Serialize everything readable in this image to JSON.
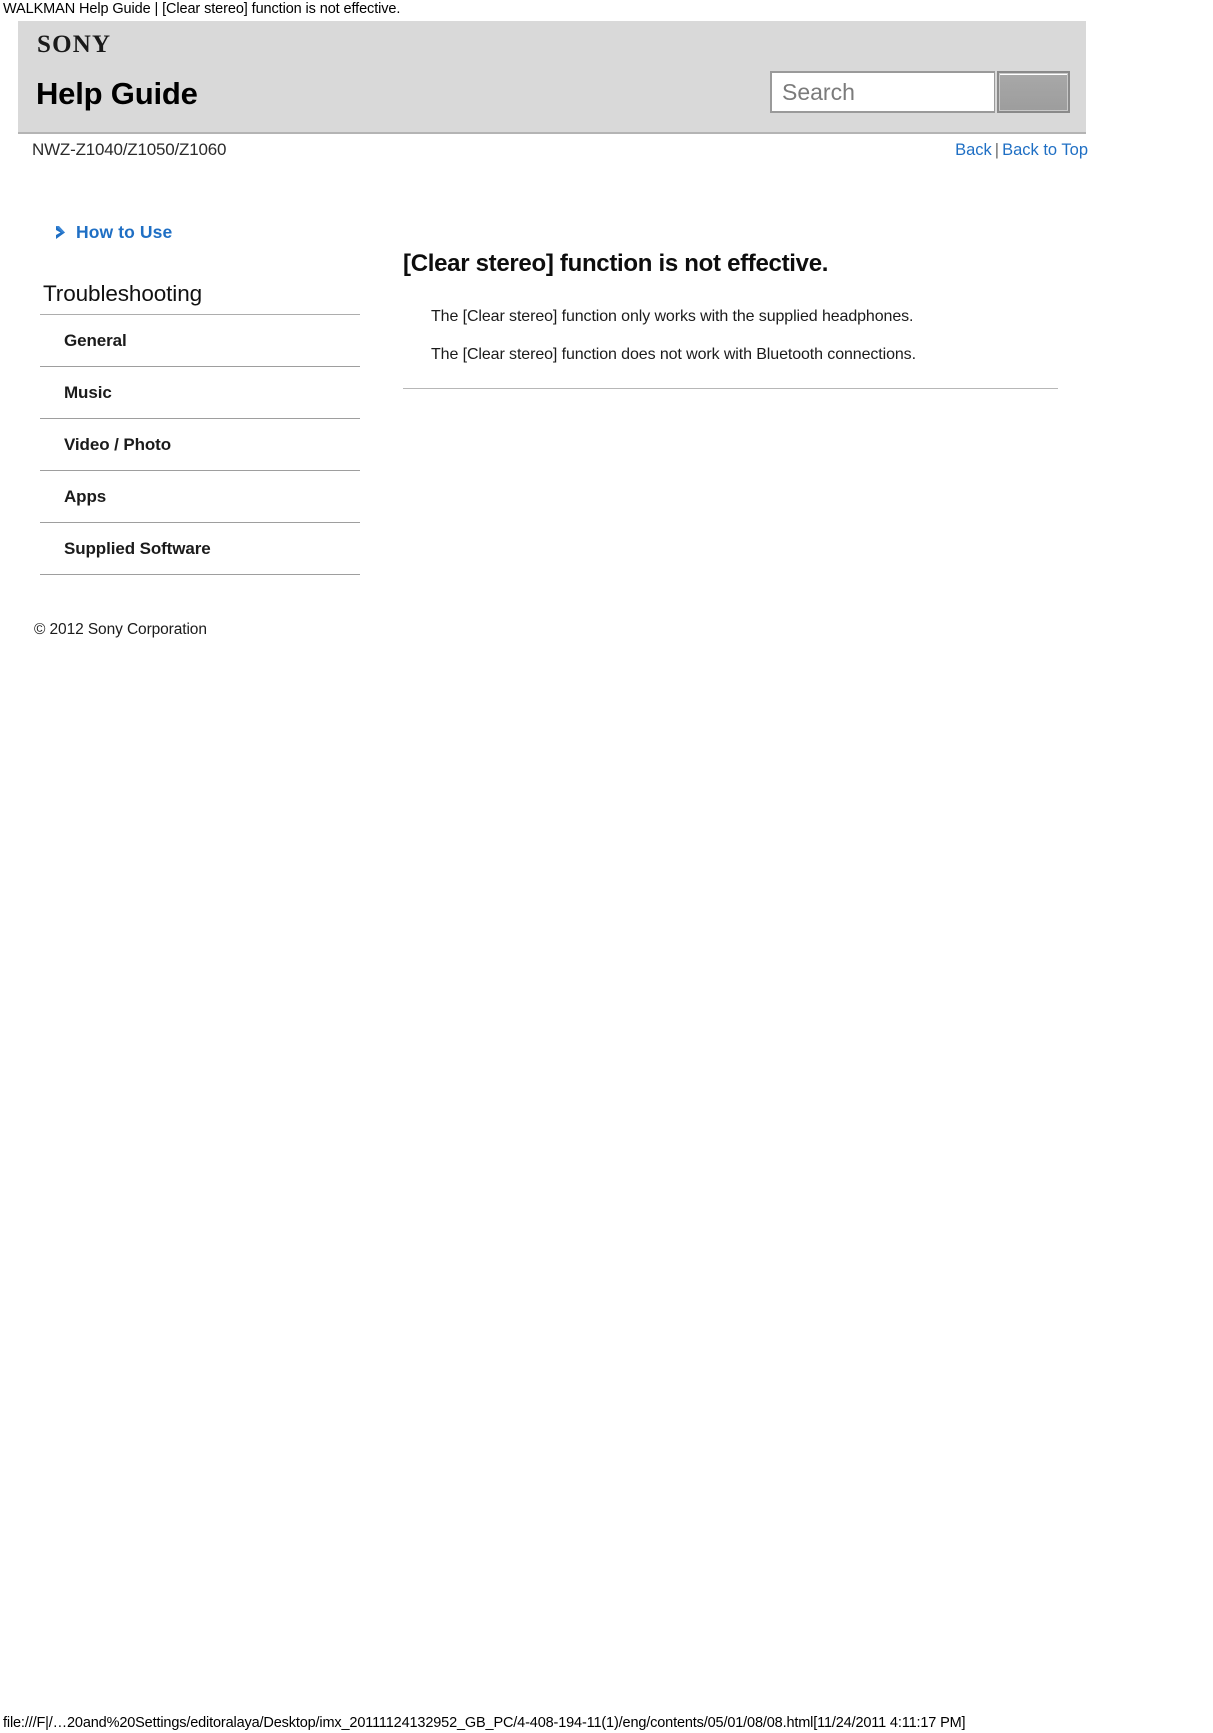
{
  "browser": {
    "page_title": "WALKMAN Help Guide | [Clear stereo] function is not effective.",
    "status_url": "file:///F|/…20and%20Settings/editoralaya/Desktop/imx_20111124132952_GB_PC/4-408-194-11(1)/eng/contents/05/01/08/08.html[11/24/2011 4:11:17 PM]"
  },
  "header": {
    "brand": "SONY",
    "title": "Help Guide",
    "search": {
      "placeholder": "Search",
      "value": "",
      "button_label": ""
    },
    "background_color": "#d9d9d9"
  },
  "subheader": {
    "model": "NWZ-Z1040/Z1050/Z1060",
    "nav": {
      "back": "Back",
      "separator": "|",
      "back_to_top": "Back to Top",
      "link_color": "#1f6fc4"
    }
  },
  "sidebar": {
    "how_to_use": "How to Use",
    "section_heading": "Troubleshooting",
    "items": [
      {
        "label": "General"
      },
      {
        "label": "Music"
      },
      {
        "label": "Video / Photo"
      },
      {
        "label": "Apps"
      },
      {
        "label": "Supplied Software"
      }
    ],
    "copyright": "© 2012 Sony Corporation"
  },
  "main": {
    "title": "[Clear stereo] function is not effective.",
    "paragraphs": [
      "The [Clear stereo] function only works with the supplied headphones.",
      "The [Clear stereo] function does not work with Bluetooth connections."
    ]
  }
}
